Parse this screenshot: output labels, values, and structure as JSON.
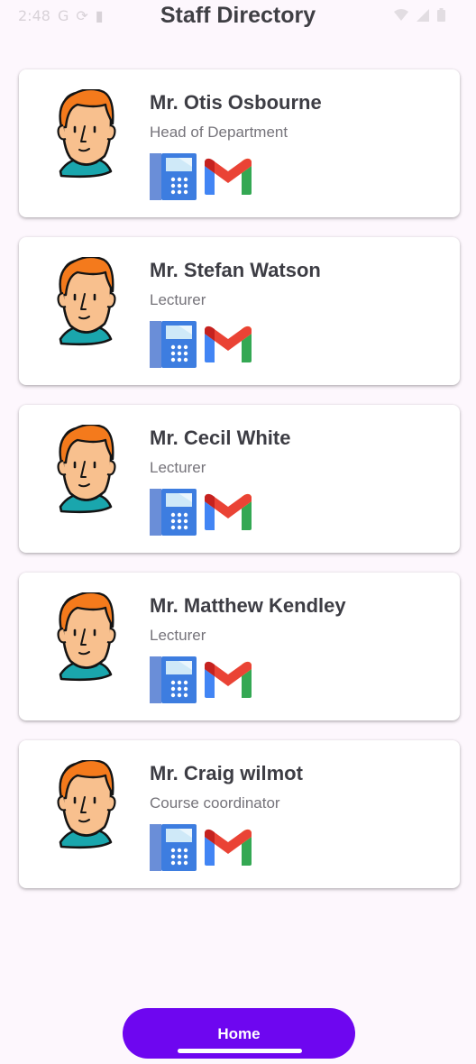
{
  "status_bar": {
    "time": "2:48",
    "carrier_icon": "G",
    "icons_left": [
      "google-g-icon",
      "sync-icon",
      "sd-card-icon"
    ],
    "icons_right": [
      "wifi-icon",
      "signal-icon",
      "battery-icon"
    ]
  },
  "header": {
    "title": "Staff Directory"
  },
  "staff": [
    {
      "name": "Mr. Otis Osbourne",
      "role": "Head of Department"
    },
    {
      "name": "Mr. Stefan Watson",
      "role": "Lecturer"
    },
    {
      "name": "Mr. Cecil White",
      "role": "Lecturer"
    },
    {
      "name": "Mr. Matthew Kendley",
      "role": "Lecturer"
    },
    {
      "name": "Mr. Craig wilmot",
      "role": "Course coordinator"
    }
  ],
  "card_icons": {
    "avatar": "person-avatar-icon",
    "phone": "phone-icon",
    "email": "gmail-icon"
  },
  "footer": {
    "home_label": "Home"
  },
  "colors": {
    "background": "#fdf7fd",
    "card": "#ffffff",
    "accent": "#6e06f0",
    "name_text": "#3d3d44",
    "role_text": "#75737a"
  }
}
